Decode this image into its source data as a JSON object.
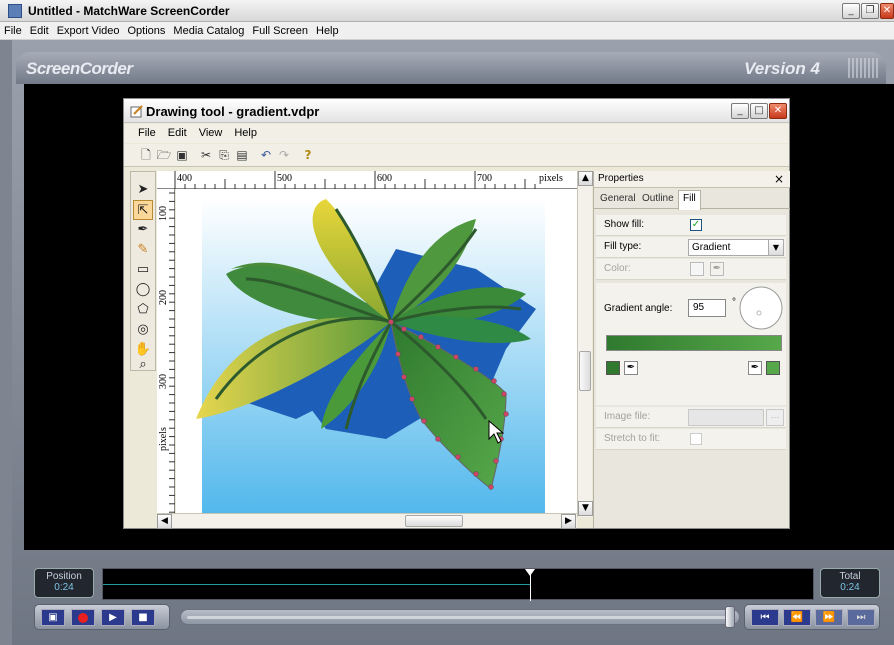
{
  "app": {
    "title": "Untitled - MatchWare ScreenCorder",
    "brand_left": "ScreenCorder",
    "brand_right": "Version 4"
  },
  "menu": [
    "File",
    "Edit",
    "Export Video",
    "Options",
    "Media Catalog",
    "Full Screen",
    "Help"
  ],
  "drawing_window": {
    "title": "Drawing tool - gradient.vdpr",
    "menu": [
      "File",
      "Edit",
      "View",
      "Help"
    ],
    "ruler_h": [
      "400",
      "500",
      "600",
      "700",
      "pixels"
    ],
    "ruler_v": [
      "100",
      "200",
      "300",
      "pixels"
    ]
  },
  "properties": {
    "header": "Properties",
    "tabs": [
      "General",
      "Outline",
      "Fill"
    ],
    "show_fill_label": "Show fill:",
    "show_fill_checked": true,
    "fill_type_label": "Fill type:",
    "fill_type_value": "Gradient",
    "color_label": "Color:",
    "gradient_angle_label": "Gradient angle:",
    "gradient_angle_value": "95",
    "degree_symbol": "°",
    "image_file_label": "Image file:",
    "stretch_label": "Stretch to fit:",
    "gradient_start": "#2f7a2f",
    "gradient_end": "#57a84a"
  },
  "player": {
    "position_label": "Position",
    "position_value": "0:24",
    "total_label": "Total",
    "total_value": "0:24",
    "progress": 0.6
  }
}
